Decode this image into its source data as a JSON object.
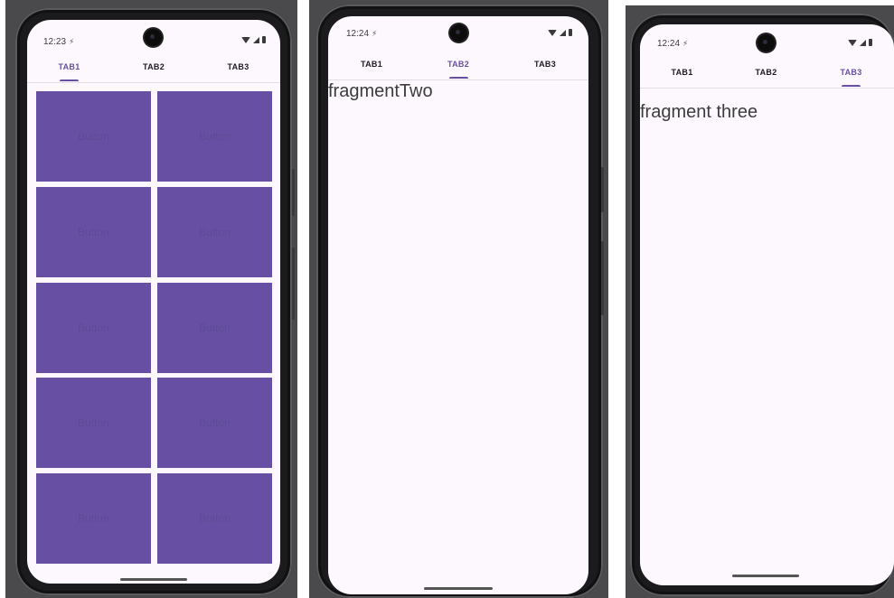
{
  "colors": {
    "accent": "#6750a4",
    "screen_background": "#fdf7fe",
    "button_fill": "#6750a4",
    "button_text": "#5e4b94"
  },
  "phone1": {
    "status_time": "12:23",
    "tabs": [
      {
        "label": "TAB1",
        "active": true
      },
      {
        "label": "TAB2",
        "active": false
      },
      {
        "label": "TAB3",
        "active": false
      }
    ],
    "grid_buttons": [
      "Button",
      "Button",
      "Button",
      "Button",
      "Button",
      "Button",
      "Button",
      "Button",
      "Button",
      "Button"
    ]
  },
  "phone2": {
    "status_time": "12:24",
    "tabs": [
      {
        "label": "TAB1",
        "active": false
      },
      {
        "label": "TAB2",
        "active": true
      },
      {
        "label": "TAB3",
        "active": false
      }
    ],
    "fragment_text": "fragmentTwo"
  },
  "phone3": {
    "status_time": "12:24",
    "tabs": [
      {
        "label": "TAB1",
        "active": false
      },
      {
        "label": "TAB2",
        "active": false
      },
      {
        "label": "TAB3",
        "active": true
      }
    ],
    "fragment_text": "fragment three"
  },
  "icons": {
    "alarm": "alarm-icon",
    "wifi": "wifi-icon",
    "signal": "cell-signal-icon",
    "battery": "battery-icon",
    "camera": "front-camera-icon"
  }
}
